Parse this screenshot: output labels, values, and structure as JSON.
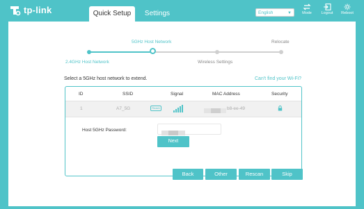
{
  "brand": {
    "name": "tp-link"
  },
  "tabs": [
    {
      "label": "Quick Setup"
    },
    {
      "label": "Settings"
    }
  ],
  "language": {
    "selected": "English"
  },
  "top_icons": [
    {
      "label": "Mode",
      "icon": "mode-icon"
    },
    {
      "label": "Logout",
      "icon": "logout-icon"
    },
    {
      "label": "Reboot",
      "icon": "reboot-icon"
    }
  ],
  "steps": {
    "top": [
      {
        "label": "5GHz Host Network"
      },
      {
        "label": "Relocate"
      }
    ],
    "bottom": [
      {
        "label": "2.4GHz Host Network"
      },
      {
        "label": "Wireless Settings"
      }
    ]
  },
  "instruction": "Select a 5GHz host network to extend.",
  "cant_find": "Can't find your Wi-Fi?",
  "table": {
    "headers": [
      "ID",
      "SSID",
      "Signal",
      "MAC Address",
      "Security"
    ],
    "row": {
      "id": "1",
      "ssid": "A7_5G",
      "badge": "Reach",
      "mac_suffix": "b8-ee-49",
      "security_icon": "lock-icon"
    }
  },
  "password": {
    "label": "Host 5GHz Password:"
  },
  "buttons": {
    "next": "Next",
    "back": "Back",
    "other": "Other",
    "rescan": "Rescan",
    "skip": "Skip"
  },
  "colors": {
    "accent": "#4fc3c8",
    "progress_gray": "#cfcfcf"
  }
}
